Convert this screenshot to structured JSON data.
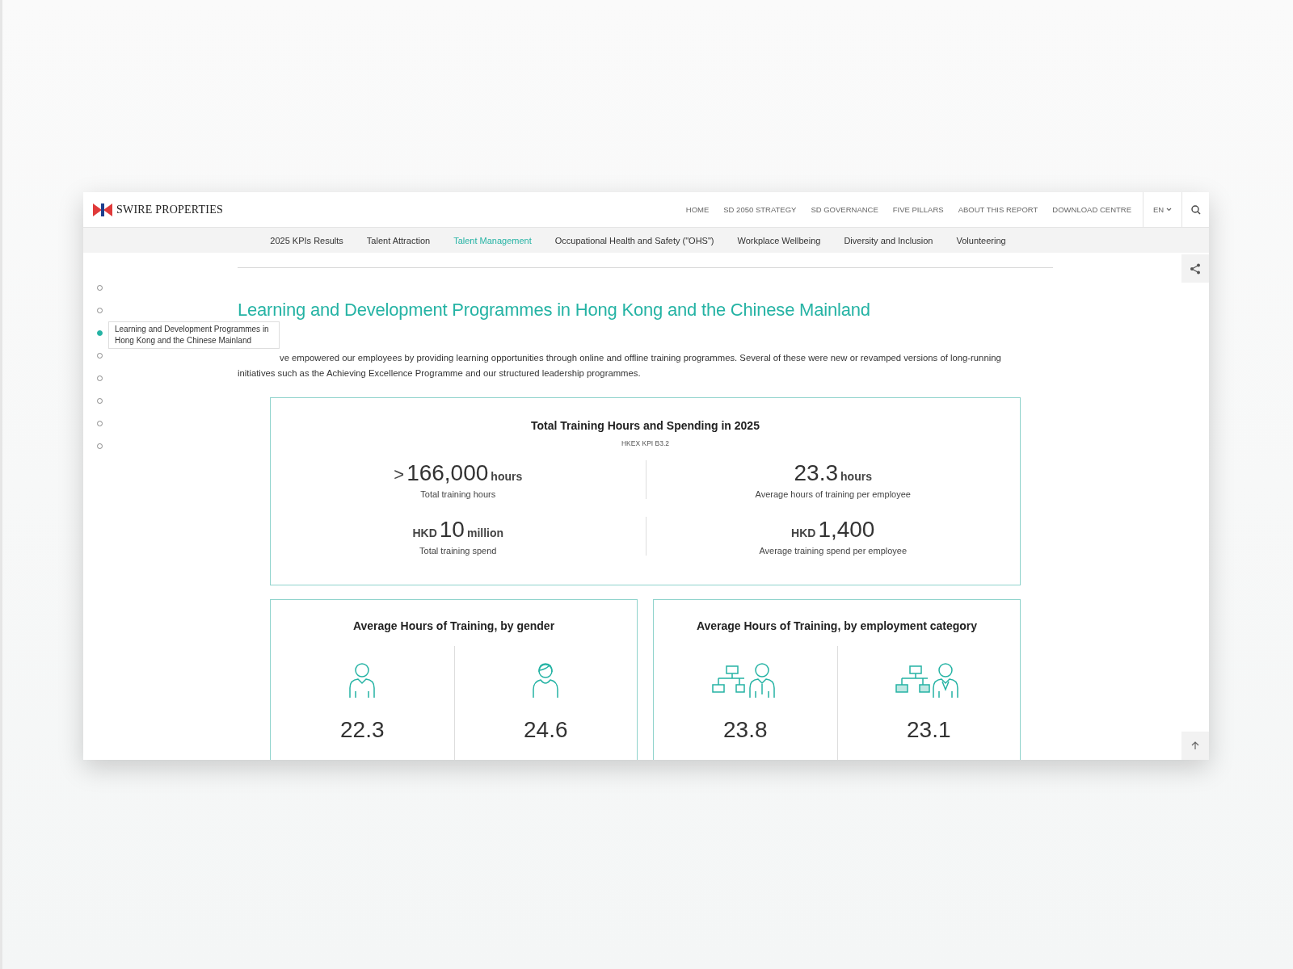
{
  "header": {
    "logo": "SWIRE PROPERTIES",
    "nav": [
      "HOME",
      "SD 2050 STRATEGY",
      "SD GOVERNANCE",
      "FIVE PILLARS",
      "ABOUT THIS REPORT",
      "DOWNLOAD CENTRE"
    ],
    "language": "EN"
  },
  "subnav": [
    {
      "label": "2025 KPIs Results",
      "selected": false
    },
    {
      "label": "Talent Attraction",
      "selected": false
    },
    {
      "label": "Talent Management",
      "selected": true
    },
    {
      "label": "Occupational Health and Safety (\"OHS\")",
      "selected": false
    },
    {
      "label": "Workplace Wellbeing",
      "selected": false
    },
    {
      "label": "Diversity and Inclusion",
      "selected": false
    },
    {
      "label": "Volunteering",
      "selected": false
    }
  ],
  "section_dots": [
    {
      "selected": false
    },
    {
      "selected": false
    },
    {
      "selected": true
    },
    {
      "selected": false
    },
    {
      "selected": false
    },
    {
      "selected": false
    },
    {
      "selected": false
    },
    {
      "selected": false
    }
  ],
  "tooltip": "Learning and Development Programmes in Hong Kong and the Chinese Mainland",
  "title": "Learning and Development Programmes in Hong Kong and the Chinese Mainland",
  "paragraph": "ve empowered our employees by providing learning opportunities through online and offline training programmes. Several of these were new or revamped versions of long-running initiatives such as the Achieving Excellence Programme and our structured leadership programmes.",
  "summary_card": {
    "title": "Total Training Hours and Spending in 2025",
    "subtitle": "HKEX KPI B3.2",
    "stats": [
      {
        "prefix": ">",
        "value": "166,000",
        "unit": "hours",
        "label": "Total training hours"
      },
      {
        "value": "23.3",
        "unit": "hours",
        "label": "Average hours of training per employee"
      },
      {
        "prefix": "HKD",
        "value": "10",
        "unit": "million",
        "label": "Total training spend"
      },
      {
        "prefix": "HKD",
        "value": "1,400",
        "label": "Average training spend per employee"
      }
    ]
  },
  "breakdown_cards": [
    {
      "title": "Average Hours of Training, by gender",
      "items": [
        {
          "kind": "male",
          "value": "22.3"
        },
        {
          "kind": "female",
          "value": "24.6"
        }
      ]
    },
    {
      "title": "Average Hours of Training, by employment category",
      "items": [
        {
          "kind": "manager",
          "value": "23.8"
        },
        {
          "kind": "staff",
          "value": "23.1"
        }
      ]
    }
  ]
}
